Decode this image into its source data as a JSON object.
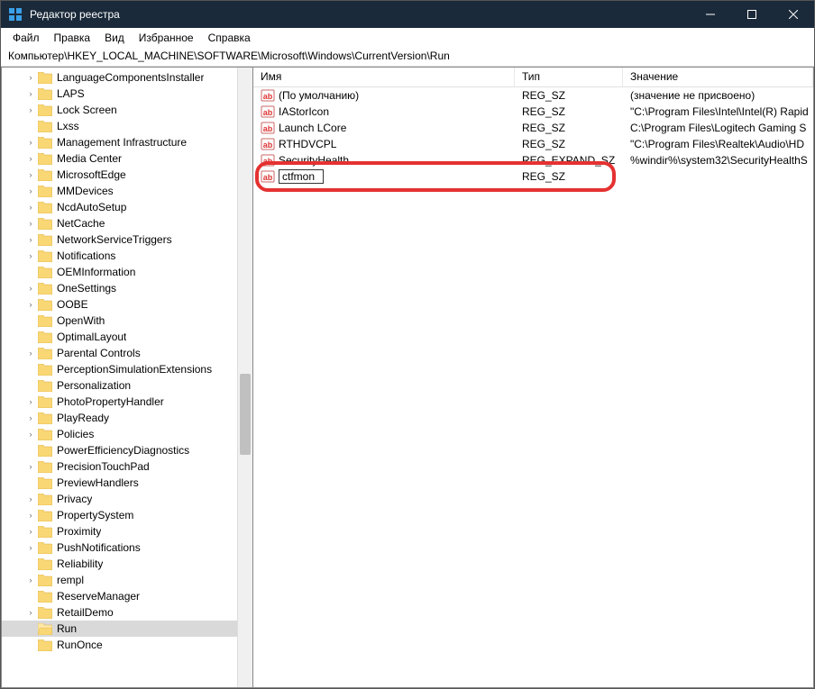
{
  "window": {
    "title": "Редактор реестра"
  },
  "menu": {
    "file": "Файл",
    "edit": "Правка",
    "view": "Вид",
    "favorites": "Избранное",
    "help": "Справка"
  },
  "address": "Компьютер\\HKEY_LOCAL_MACHINE\\SOFTWARE\\Microsoft\\Windows\\CurrentVersion\\Run",
  "tree": {
    "items": [
      {
        "label": "LanguageComponentsInstaller",
        "expandable": true
      },
      {
        "label": "LAPS",
        "expandable": true
      },
      {
        "label": "Lock Screen",
        "expandable": true
      },
      {
        "label": "Lxss",
        "expandable": false
      },
      {
        "label": "Management Infrastructure",
        "expandable": true
      },
      {
        "label": "Media Center",
        "expandable": true
      },
      {
        "label": "MicrosoftEdge",
        "expandable": true
      },
      {
        "label": "MMDevices",
        "expandable": true
      },
      {
        "label": "NcdAutoSetup",
        "expandable": true
      },
      {
        "label": "NetCache",
        "expandable": true
      },
      {
        "label": "NetworkServiceTriggers",
        "expandable": true
      },
      {
        "label": "Notifications",
        "expandable": true
      },
      {
        "label": "OEMInformation",
        "expandable": false
      },
      {
        "label": "OneSettings",
        "expandable": true
      },
      {
        "label": "OOBE",
        "expandable": true
      },
      {
        "label": "OpenWith",
        "expandable": false
      },
      {
        "label": "OptimalLayout",
        "expandable": false
      },
      {
        "label": "Parental Controls",
        "expandable": true
      },
      {
        "label": "PerceptionSimulationExtensions",
        "expandable": false
      },
      {
        "label": "Personalization",
        "expandable": false
      },
      {
        "label": "PhotoPropertyHandler",
        "expandable": true
      },
      {
        "label": "PlayReady",
        "expandable": true
      },
      {
        "label": "Policies",
        "expandable": true
      },
      {
        "label": "PowerEfficiencyDiagnostics",
        "expandable": false
      },
      {
        "label": "PrecisionTouchPad",
        "expandable": true
      },
      {
        "label": "PreviewHandlers",
        "expandable": false
      },
      {
        "label": "Privacy",
        "expandable": true
      },
      {
        "label": "PropertySystem",
        "expandable": true
      },
      {
        "label": "Proximity",
        "expandable": true
      },
      {
        "label": "PushNotifications",
        "expandable": true
      },
      {
        "label": "Reliability",
        "expandable": false
      },
      {
        "label": "rempl",
        "expandable": true
      },
      {
        "label": "ReserveManager",
        "expandable": false
      },
      {
        "label": "RetailDemo",
        "expandable": true
      },
      {
        "label": "Run",
        "expandable": false,
        "selected": true
      },
      {
        "label": "RunOnce",
        "expandable": false
      }
    ]
  },
  "list": {
    "headers": {
      "name": "Имя",
      "type": "Тип",
      "data": "Значение"
    },
    "rows": [
      {
        "name": "(По умолчанию)",
        "type": "REG_SZ",
        "data": "(значение не присвоено)"
      },
      {
        "name": "IAStorIcon",
        "type": "REG_SZ",
        "data": "\"C:\\Program Files\\Intel\\Intel(R) Rapid"
      },
      {
        "name": "Launch LCore",
        "type": "REG_SZ",
        "data": "C:\\Program Files\\Logitech Gaming S"
      },
      {
        "name": "RTHDVCPL",
        "type": "REG_SZ",
        "data": "\"C:\\Program Files\\Realtek\\Audio\\HD"
      },
      {
        "name": "SecurityHealth",
        "type": "REG_EXPAND_SZ",
        "data": "%windir%\\system32\\SecurityHealthS"
      },
      {
        "name": "ctfmon",
        "type": "REG_SZ",
        "data": "",
        "editing": true
      }
    ]
  }
}
